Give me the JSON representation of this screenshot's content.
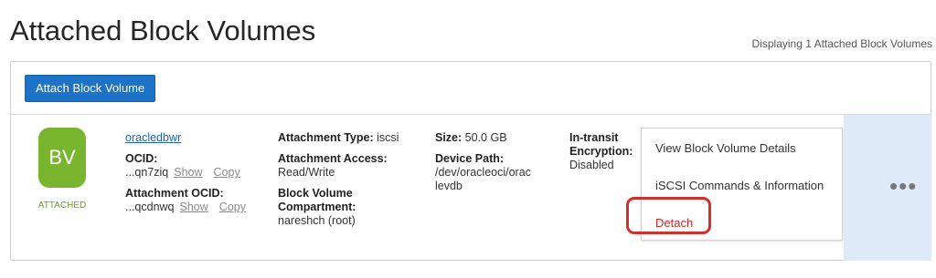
{
  "header": {
    "title": "Attached Block Volumes",
    "displaying_text": "Displaying 1 Attached Block Volumes"
  },
  "toolbar": {
    "attach_label": "Attach Block Volume"
  },
  "volume": {
    "badge_text": "BV",
    "status": "ATTACHED",
    "name": "oracledbwr",
    "ocid_label": "OCID:",
    "ocid_value": "...qn7ziq",
    "show_label": "Show",
    "copy_label": "Copy",
    "attachment_ocid_label": "Attachment OCID:",
    "attachment_ocid_value": "...qcdnwq",
    "attachment_type_label": "Attachment Type:",
    "attachment_type_value": "iscsi",
    "attachment_access_label": "Attachment Access:",
    "attachment_access_value": "Read/Write",
    "compartment_label_line1": "Block Volume",
    "compartment_label_line2": "Compartment:",
    "compartment_value": "nareshch (root)",
    "size_label": "Size:",
    "size_value": "50.0 GB",
    "device_path_label": "Device Path:",
    "device_path_line1": "/dev/oracleoci/orac",
    "device_path_line2": "levdb",
    "encryption_label_line1": "In-transit",
    "encryption_label_line2": "Encryption:",
    "encryption_value": "Disabled"
  },
  "actions_menu": {
    "items": [
      "View Block Volume Details",
      "iSCSI Commands & Information",
      "Detach"
    ],
    "more_icon": "more-icon"
  },
  "colors": {
    "accent": "#1c73c7",
    "badge": "#7ab52f",
    "detach": "#c52a2a",
    "highlight": "#d0312d"
  }
}
